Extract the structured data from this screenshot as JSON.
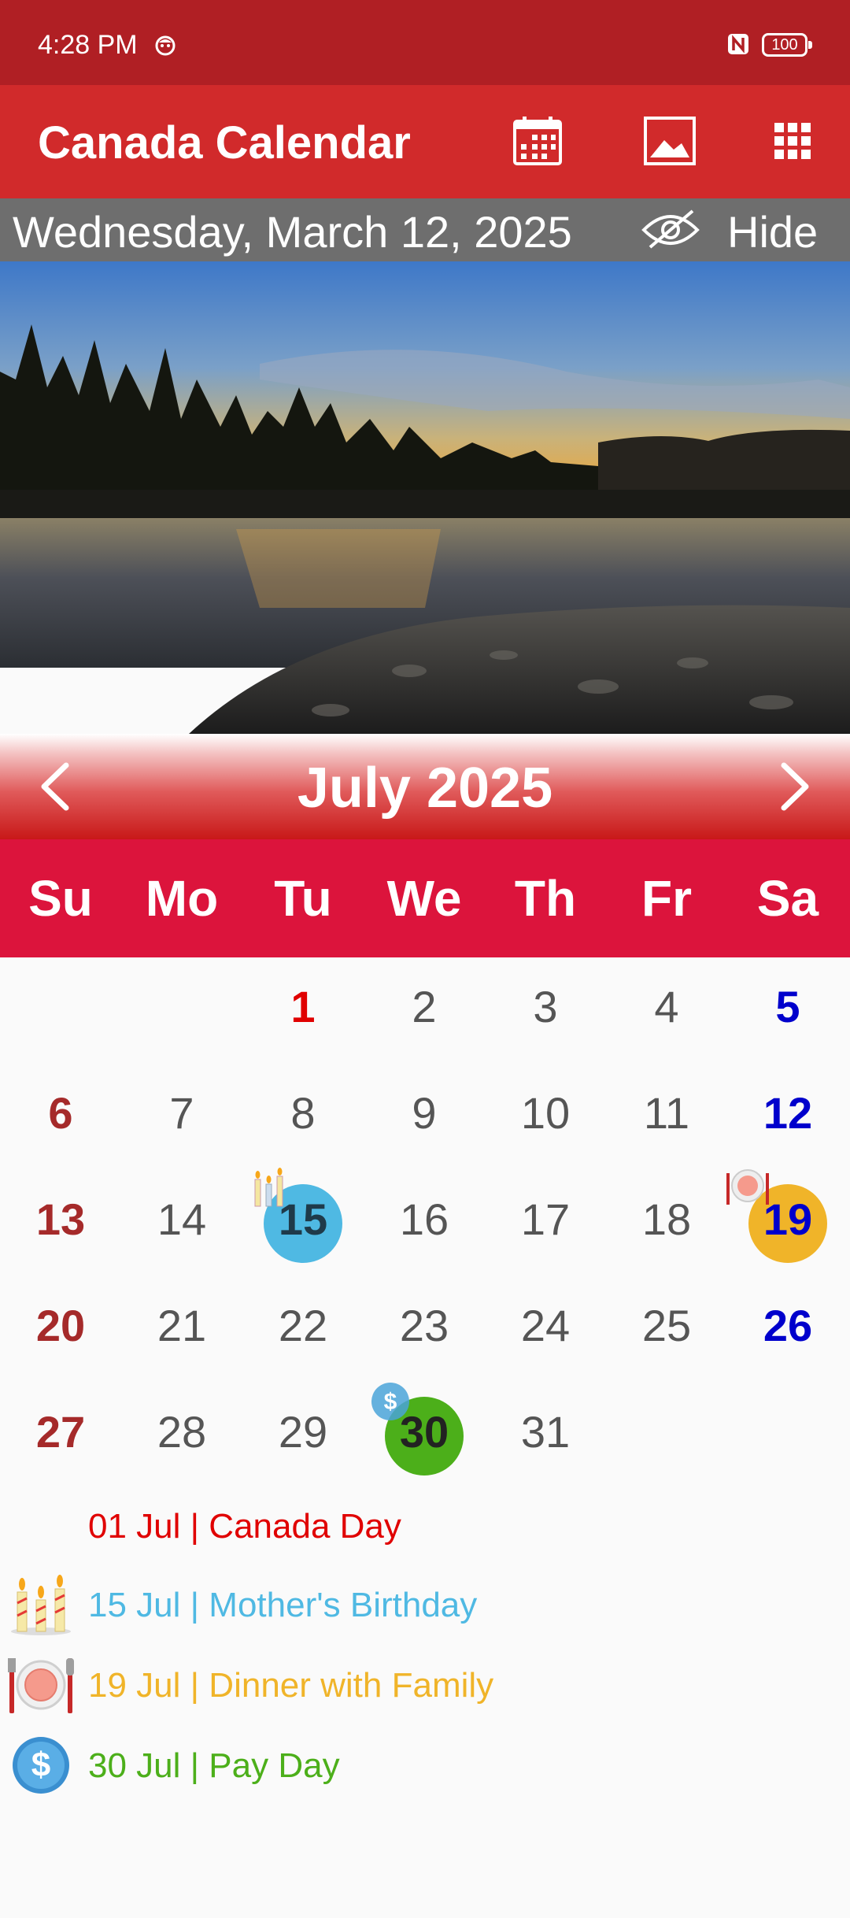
{
  "status": {
    "time": "4:28 PM",
    "battery": "100"
  },
  "app": {
    "title": "Canada Calendar"
  },
  "date_strip": {
    "date": "Wednesday, March 12, 2025",
    "hide_label": "Hide"
  },
  "month": {
    "title": "July 2025"
  },
  "weekdays": [
    "Su",
    "Mo",
    "Tu",
    "We",
    "Th",
    "Fr",
    "Sa"
  ],
  "days": [
    "1",
    "2",
    "3",
    "4",
    "5",
    "6",
    "7",
    "8",
    "9",
    "10",
    "11",
    "12",
    "13",
    "14",
    "15",
    "16",
    "17",
    "18",
    "19",
    "20",
    "21",
    "22",
    "23",
    "24",
    "25",
    "26",
    "27",
    "28",
    "29",
    "30",
    "31"
  ],
  "events": [
    {
      "text": "01 Jul | Canada Day",
      "color": "#e00000",
      "icon": ""
    },
    {
      "text": "15 Jul | Mother's Birthday",
      "color": "#4fb9e3",
      "icon": "birthday-candles-icon"
    },
    {
      "text": "19 Jul | Dinner with Family",
      "color": "#f0b429",
      "icon": "dinner-plate-icon"
    },
    {
      "text": "30 Jul | Pay Day",
      "color": "#4caf1a",
      "icon": "dollar-coin-icon"
    }
  ],
  "colors": {
    "status_bar": "#b01f24",
    "app_bar": "#d12a2b",
    "weekday_bar": "#dc143c",
    "sunday": "#a52a2a",
    "saturday": "#0000cc",
    "holiday": "#e00000",
    "birthday": "#4fb9e3",
    "dinner": "#f0b429",
    "payday": "#4caf1a"
  }
}
